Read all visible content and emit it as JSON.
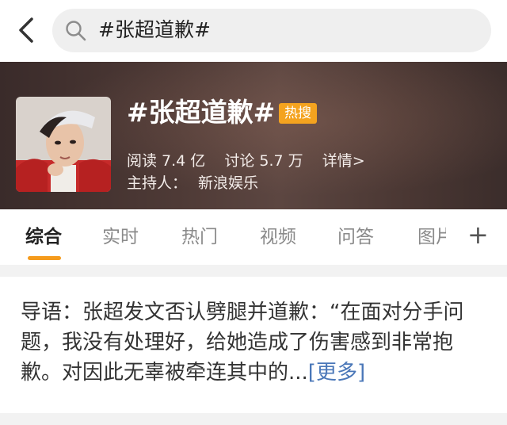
{
  "search": {
    "query": "#张超道歉#"
  },
  "header": {
    "topic_title": "#张超道歉#",
    "hot_badge": "热搜",
    "reads": "阅读 7.4 亿",
    "discussions": "讨论 5.7 万",
    "details_link": "详情>",
    "host_label": "主持人：",
    "host_name": "新浪娱乐"
  },
  "tabs": [
    {
      "label": "综合",
      "active": true
    },
    {
      "label": "实时"
    },
    {
      "label": "热门"
    },
    {
      "label": "视频"
    },
    {
      "label": "问答"
    },
    {
      "label": "图片"
    }
  ],
  "lead": {
    "text": "导语：张超发文否认劈腿并道歉：“在面对分手问题，我没有处理好，给她造成了伤害感到非常抱歉。对因此无辜被牵连其中的...",
    "more_link": "[更多]"
  },
  "colors": {
    "accent_orange": "#f59b1c",
    "hot_badge": "#f4a31f",
    "link_blue": "#4a77b8"
  }
}
